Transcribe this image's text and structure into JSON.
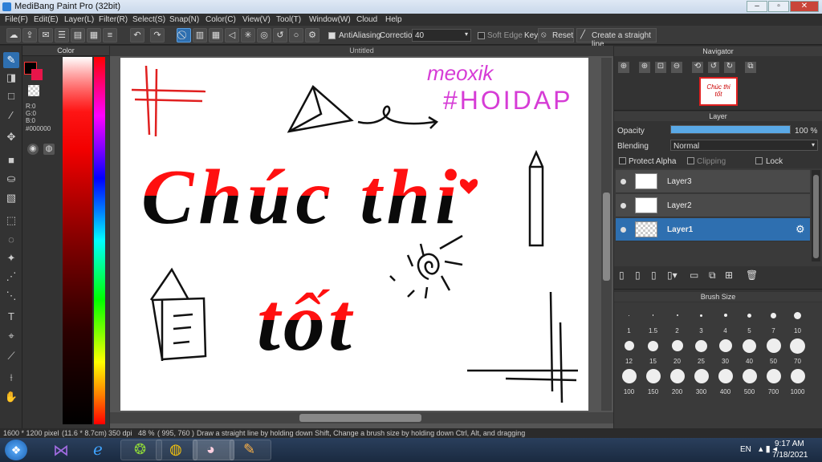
{
  "window": {
    "title": "MediBang Paint Pro (32bit)"
  },
  "menu": [
    "File(F)",
    "Edit(E)",
    "Layer(L)",
    "Filter(R)",
    "Select(S)",
    "Snap(N)",
    "Color(C)",
    "View(V)",
    "Tool(T)",
    "Window(W)",
    "Cloud",
    "Help"
  ],
  "toolbar": {
    "antialiasing_label": "AntiAliasing",
    "correction_label": "Correction",
    "correction_value": "40",
    "soft_edge_label": "Soft Edge",
    "key_label": "Key",
    "reset_label": "Reset",
    "straight_line_label": "Create a straight line"
  },
  "color_panel": {
    "title": "Color",
    "r": "R:0",
    "g": "G:0",
    "b": "B:0",
    "hex": "#000000"
  },
  "canvas": {
    "tab_title": "Untitled",
    "text": {
      "meoxik": "meoxik",
      "hashtag": "#HOIDAP",
      "line1": "Chúc thi",
      "line2": "tốt"
    }
  },
  "navigator": {
    "title": "Navigator"
  },
  "layer_panel": {
    "title": "Layer",
    "opacity_label": "Opacity",
    "opacity_value": "100 %",
    "opacity": 1.0,
    "blending_label": "Blending",
    "blending_value": "Normal",
    "protect_alpha": "Protect Alpha",
    "clipping": "Clipping",
    "lock": "Lock",
    "layers": [
      {
        "name": "Layer3"
      },
      {
        "name": "Layer2"
      },
      {
        "name": "Layer1",
        "selected": true
      }
    ]
  },
  "brush_size": {
    "title": "Brush Size",
    "sizes": [
      "1",
      "1.5",
      "2",
      "3",
      "4",
      "5",
      "7",
      "10",
      "12",
      "15",
      "20",
      "25",
      "30",
      "40",
      "50",
      "70",
      "100",
      "150",
      "200",
      "300",
      "400",
      "500",
      "700",
      "1000"
    ]
  },
  "status": {
    "dimensions": "1600 * 1200 pixel",
    "physical": "(11.6 * 8.7cm)",
    "dpi": "350 dpi",
    "zoom": "48 %",
    "coords": "( 995, 760 )",
    "hint": "Draw a straight line by holding down Shift, Change a brush size by holding down Ctrl, Alt, and dragging"
  },
  "taskbar": {
    "lang": "EN",
    "time": "9:17 AM",
    "date": "7/18/2021"
  },
  "colors": {
    "accent": "#2e6fb0",
    "red": "#ff0000",
    "magenta": "#d63cd6"
  }
}
